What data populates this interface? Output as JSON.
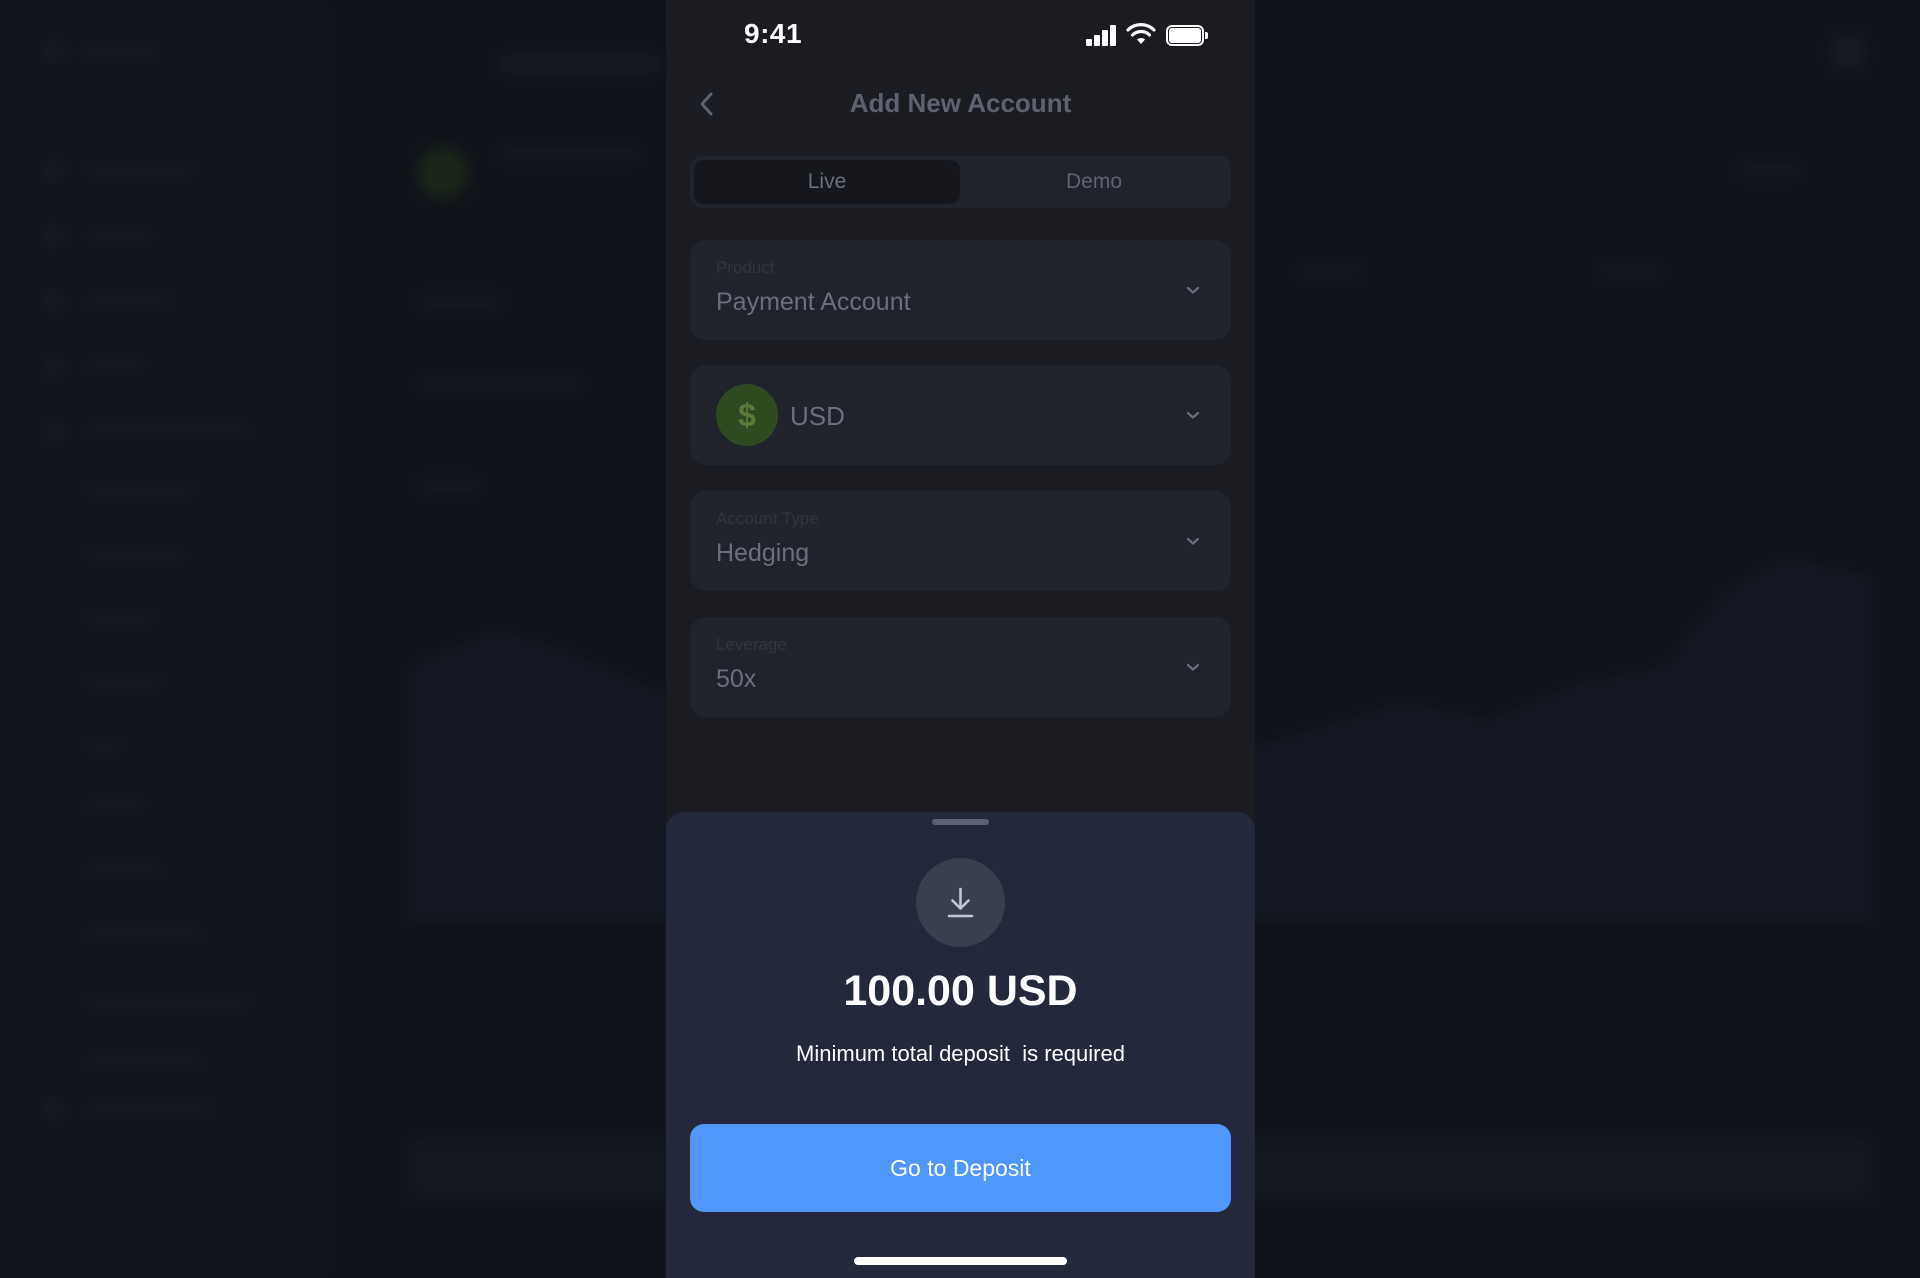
{
  "status_bar": {
    "time": "9:41"
  },
  "header": {
    "title": "Add New Account"
  },
  "tabs": [
    {
      "label": "Live",
      "selected": true
    },
    {
      "label": "Demo",
      "selected": false
    }
  ],
  "form": {
    "product": {
      "label": "Product",
      "value": "Payment Account"
    },
    "currency": {
      "value": "USD",
      "symbol": "$"
    },
    "account_type": {
      "label": "Account Type",
      "value": "Hedging"
    },
    "leverage": {
      "label": "Leverage",
      "value": "50x"
    }
  },
  "sheet": {
    "amount": "100.00 USD",
    "message": "Minimum total deposit  is required",
    "button_label": "Go to Deposit",
    "icon": "download-icon"
  },
  "colors": {
    "accent": "#4f97fb",
    "sheet_bg": "#23283a",
    "screen_bg": "#1a1c22"
  }
}
